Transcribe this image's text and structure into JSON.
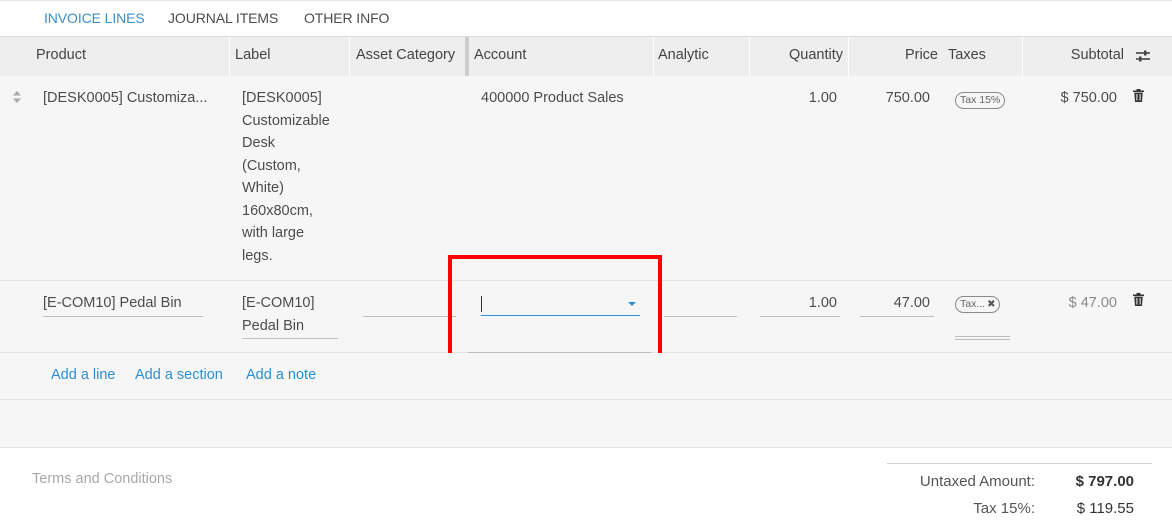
{
  "tabs": [
    {
      "label": "INVOICE LINES",
      "active": true
    },
    {
      "label": "JOURNAL ITEMS",
      "active": false
    },
    {
      "label": "OTHER INFO",
      "active": false
    }
  ],
  "columns": {
    "product": "Product",
    "label": "Label",
    "asset_category": "Asset Category",
    "account": "Account",
    "analytic": "Analytic",
    "quantity": "Quantity",
    "price": "Price",
    "taxes": "Taxes",
    "subtotal": "Subtotal"
  },
  "lines": [
    {
      "product": "[DESK0005] Customiza...",
      "label_lines": [
        "[DESK0005]",
        "Customizable",
        "Desk",
        "(Custom,",
        "White)",
        "160x80cm,",
        "with large",
        "legs."
      ],
      "account": "400000 Product Sales",
      "quantity": "1.00",
      "price": "750.00",
      "tax": "Tax 15%",
      "subtotal": "$ 750.00"
    },
    {
      "product": "[E-COM10] Pedal Bin",
      "label_lines": [
        "[E-COM10]",
        "Pedal Bin"
      ],
      "account": "",
      "quantity": "1.00",
      "price": "47.00",
      "tax": "Tax...",
      "subtotal": "$ 47.00"
    }
  ],
  "actions": {
    "add_line": "Add a line",
    "add_section": "Add a section",
    "add_note": "Add a note"
  },
  "footer": {
    "terms_placeholder": "Terms and Conditions",
    "untaxed_label": "Untaxed Amount:",
    "untaxed_value": "$ 797.00",
    "tax_label": "Tax 15%:",
    "tax_value": "$ 119.55"
  },
  "colors": {
    "accent": "#3c8ec9",
    "link": "#2b8fd4",
    "highlight": "#ff0000"
  }
}
